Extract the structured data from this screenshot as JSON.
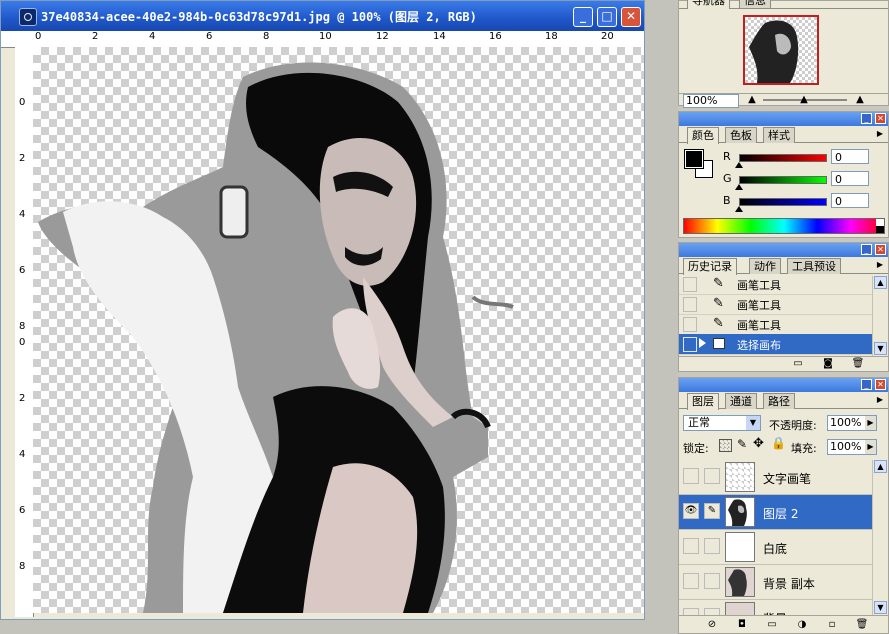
{
  "document": {
    "title": "37e40834-acee-40e2-984b-0c63d78c97d1.jpg @ 100% (图层 2, RGB)",
    "ruler_h": [
      "0",
      "2",
      "4",
      "6",
      "8",
      "10",
      "12",
      "14",
      "16",
      "18",
      "20"
    ],
    "ruler_v": [
      "0",
      "2",
      "4",
      "6",
      "8",
      "0",
      "2",
      "4",
      "6",
      "8"
    ]
  },
  "navigator": {
    "tabs": [
      "导航器",
      "信息"
    ],
    "zoom": "100%"
  },
  "color_panel": {
    "tabs": [
      "颜色",
      "色板",
      "样式"
    ],
    "channels": [
      {
        "label": "R",
        "value": "0",
        "color": "#c00000"
      },
      {
        "label": "G",
        "value": "0",
        "color": "#00a000"
      },
      {
        "label": "B",
        "value": "0",
        "color": "#0000c0"
      }
    ]
  },
  "history": {
    "tabs": [
      "历史记录",
      "动作",
      "工具预设"
    ],
    "items": [
      {
        "label": "画笔工具",
        "icon": "brush-icon",
        "selected": false
      },
      {
        "label": "画笔工具",
        "icon": "brush-icon",
        "selected": false
      },
      {
        "label": "画笔工具",
        "icon": "brush-icon",
        "selected": false
      },
      {
        "label": "选择画布",
        "icon": "select-canvas-icon",
        "selected": true
      }
    ]
  },
  "layers": {
    "tabs": [
      "图层",
      "通道",
      "路径"
    ],
    "blend_mode": "正常",
    "opacity_label": "不透明度:",
    "opacity": "100%",
    "lock_label": "锁定:",
    "fill_label": "填充:",
    "fill": "100%",
    "items": [
      {
        "name": "文字画笔",
        "visible": false,
        "selected": false
      },
      {
        "name": "图层 2",
        "visible": true,
        "selected": true
      },
      {
        "name": "白底",
        "visible": false,
        "selected": false
      },
      {
        "name": "背景 副本",
        "visible": false,
        "selected": false
      },
      {
        "name": "背景",
        "visible": false,
        "selected": false
      }
    ]
  }
}
